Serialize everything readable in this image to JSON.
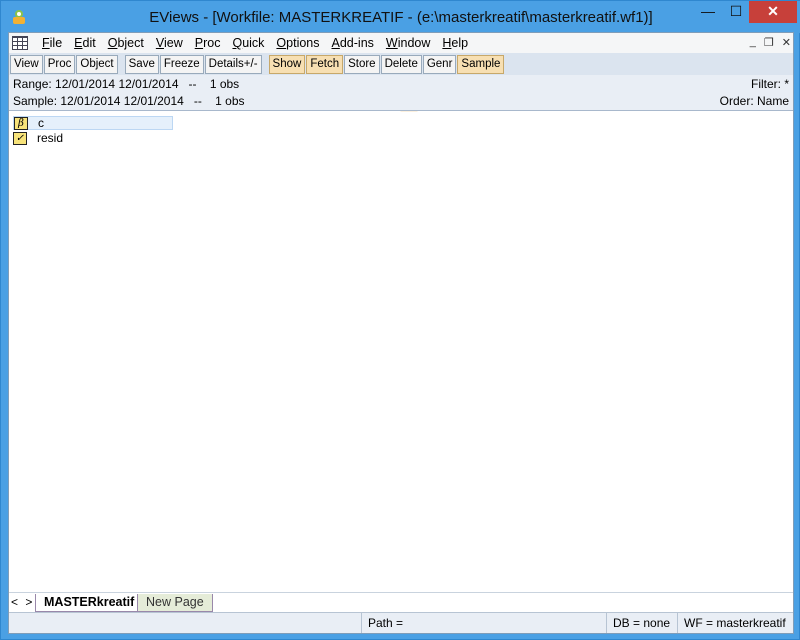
{
  "window": {
    "title": "EViews - [Workfile: MASTERKREATIF - (e:\\masterkreatif\\masterkreatif.wf1)]",
    "min_glyph": "—",
    "max_glyph": "☐",
    "close_glyph": "✕"
  },
  "menu": {
    "items": [
      "File",
      "Edit",
      "Object",
      "View",
      "Proc",
      "Quick",
      "Options",
      "Add-ins",
      "Window",
      "Help"
    ],
    "mdi_min": "_",
    "mdi_restore": "❐",
    "mdi_close": "✕"
  },
  "toolbar": {
    "group1": [
      "View",
      "Proc",
      "Object"
    ],
    "group2": [
      "Save",
      "Freeze",
      "Details+/-"
    ],
    "group3": [
      "Show",
      "Fetch",
      "Store",
      "Delete",
      "Genr",
      "Sample"
    ]
  },
  "info": {
    "range_label": "Range:",
    "range_value": "12/01/2014 12/01/2014   --    1 obs",
    "sample_label": "Sample:",
    "sample_value": "12/01/2014 12/01/2014   --    1 obs",
    "filter": "Filter: *",
    "order": "Order: Name"
  },
  "objects": [
    {
      "name": "c",
      "icon": "coefficient-icon",
      "glyph": "β"
    },
    {
      "name": "resid",
      "icon": "series-icon",
      "glyph": "✓"
    }
  ],
  "tabs": {
    "nav": "< >",
    "active": "MASTERkreatif",
    "new_page": "New Page"
  },
  "status": {
    "path": "Path =",
    "db": "DB = none",
    "wf": "WF = masterkreatif"
  },
  "colors": {
    "titlebar": "#4aa0e4",
    "close_button": "#c7403a",
    "toolbar_warm": "#f7dfb2",
    "watermark": "#f4c27a"
  }
}
